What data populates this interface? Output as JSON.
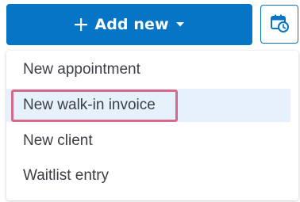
{
  "add_button": {
    "label": "Add new",
    "icon": "plus-icon",
    "dropdown_icon": "caret-down-icon"
  },
  "calendar_button": {
    "icon": "calendar-clock-icon"
  },
  "menu": {
    "items": [
      {
        "label": "New appointment"
      },
      {
        "label": "New walk-in invoice",
        "hovered": true
      },
      {
        "label": "New client"
      },
      {
        "label": "Waitlist entry"
      }
    ]
  },
  "colors": {
    "primary": "#0775c6",
    "hover_bg": "#e6f1fb",
    "highlight_border": "#d4698a",
    "text": "#3b3f45"
  }
}
